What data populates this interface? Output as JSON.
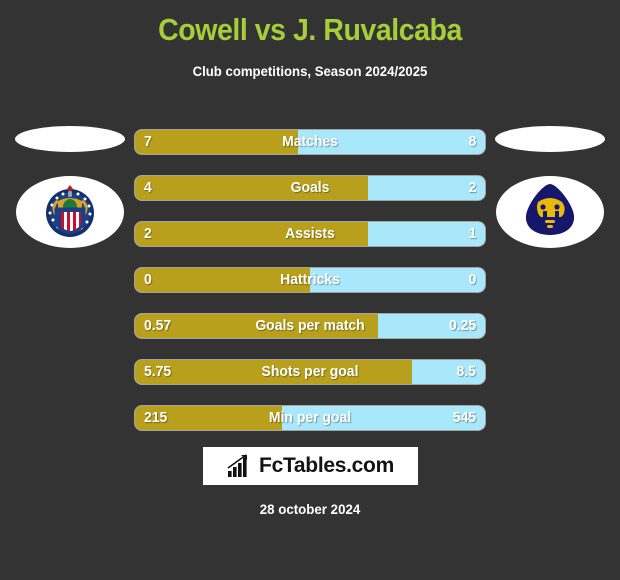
{
  "header": {
    "title": "Cowell vs J. Ruvalcaba",
    "subtitle": "Club competitions, Season 2024/2025",
    "title_color": "#a6ce39"
  },
  "teams": {
    "home": {
      "crest": "chivas-guadalajara-crest",
      "color": "#b8a01c"
    },
    "away": {
      "crest": "pumas-unam-crest",
      "color": "#a9e7fa"
    }
  },
  "chart_data": {
    "type": "bar",
    "title": "Cowell vs J. Ruvalcaba",
    "subtitle": "Club competitions, Season 2024/2025",
    "orientation": "horizontal-diverging",
    "categories": [
      "Matches",
      "Goals",
      "Assists",
      "Hattricks",
      "Goals per match",
      "Shots per goal",
      "Min per goal"
    ],
    "series": [
      {
        "name": "Cowell",
        "color": "#b8a01c",
        "values": [
          7,
          4,
          2,
          0,
          0.57,
          5.75,
          215
        ]
      },
      {
        "name": "J. Ruvalcaba",
        "color": "#a9e7fa",
        "values": [
          8,
          2,
          1,
          0,
          0.25,
          8.5,
          545
        ]
      }
    ],
    "legend": "none",
    "grid": false
  },
  "rows": [
    {
      "label": "Matches",
      "home": "7",
      "away": "8",
      "home_pct": 46.7
    },
    {
      "label": "Goals",
      "home": "4",
      "away": "2",
      "home_pct": 66.7
    },
    {
      "label": "Assists",
      "home": "2",
      "away": "1",
      "home_pct": 66.7
    },
    {
      "label": "Hattricks",
      "home": "0",
      "away": "0",
      "home_pct": 50.0
    },
    {
      "label": "Goals per match",
      "home": "0.57",
      "away": "0.25",
      "home_pct": 69.5
    },
    {
      "label": "Shots per goal",
      "home": "5.75",
      "away": "8.5",
      "home_pct": 79.0
    },
    {
      "label": "Min per goal",
      "home": "215",
      "away": "545",
      "home_pct": 42.0
    }
  ],
  "footer": {
    "logo_text": "FcTables.com",
    "logo_icon": "bar-chart-arrow-icon",
    "date": "28 october 2024"
  }
}
